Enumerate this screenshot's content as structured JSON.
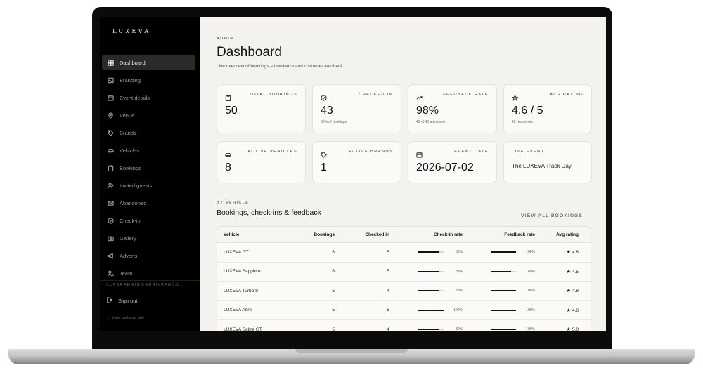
{
  "sidebar": {
    "logo": "LUXEVA",
    "items": [
      {
        "label": "Dashboard",
        "icon": "dashboard-icon",
        "active": true
      },
      {
        "label": "Branding",
        "icon": "image-icon"
      },
      {
        "label": "Event details",
        "icon": "calendar-icon"
      },
      {
        "label": "Venue",
        "icon": "map-pin-icon"
      },
      {
        "label": "Brands",
        "icon": "tag-icon"
      },
      {
        "label": "Vehicles",
        "icon": "car-icon"
      },
      {
        "label": "Bookings",
        "icon": "clipboard-icon"
      },
      {
        "label": "Invited guests",
        "icon": "user-plus-icon"
      },
      {
        "label": "Abandoned",
        "icon": "mail-icon"
      },
      {
        "label": "Check-in",
        "icon": "check-circle-icon"
      },
      {
        "label": "Gallery",
        "icon": "camera-icon"
      },
      {
        "label": "Adverts",
        "icon": "megaphone-icon"
      },
      {
        "label": "Team",
        "icon": "users-icon"
      }
    ],
    "user": "SUPERADMIN@ARRIVEANDO…",
    "sign_out": "Sign out",
    "view_site": "← View customer site"
  },
  "header": {
    "eyebrow": "ADMIN",
    "title": "Dashboard",
    "subtitle": "Live overview of bookings, attendance and customer feedback."
  },
  "stats": {
    "total_bookings": {
      "label": "TOTAL BOOKINGS",
      "value": "50"
    },
    "checked_in": {
      "label": "CHECKED IN",
      "value": "43",
      "sub": "86% of bookings"
    },
    "feedback_rate": {
      "label": "FEEDBACK RATE",
      "value": "98%",
      "sub": "42 of 43 attendees"
    },
    "avg_rating": {
      "label": "AVG RATING",
      "value": "4.6 / 5",
      "sub": "42 responses"
    },
    "active_vehicles": {
      "label": "ACTIVE VEHICLES",
      "value": "8"
    },
    "active_brands": {
      "label": "ACTIVE BRANDS",
      "value": "1"
    },
    "event_date": {
      "label": "EVENT DATE",
      "value": "2026-07-02"
    },
    "live_event": {
      "label": "LIVE EVENT",
      "value": "The LUXEVA Track Day"
    }
  },
  "section": {
    "eyebrow": "BY VEHICLE",
    "title": "Bookings, check-ins & feedback",
    "view_all": "VIEW ALL BOOKINGS →"
  },
  "table": {
    "headers": [
      "Vehicle",
      "Bookings",
      "Checked in",
      "Check-in rate",
      "Feedback rate",
      "Avg rating"
    ],
    "rows": [
      {
        "vehicle": "LUXEVA GT",
        "bookings": "6",
        "checked_in": "5",
        "checkin_rate": "83%",
        "checkin_frac": 0.83,
        "feedback_rate": "100%",
        "feedback_frac": 1.0,
        "avg_rating": "4.6"
      },
      {
        "vehicle": "LUXEVA Sapphire",
        "bookings": "6",
        "checked_in": "5",
        "checkin_rate": "83%",
        "checkin_frac": 0.83,
        "feedback_rate": "80%",
        "feedback_frac": 0.8,
        "avg_rating": "4.5"
      },
      {
        "vehicle": "LUXEVA Turbo S",
        "bookings": "5",
        "checked_in": "4",
        "checkin_rate": "80%",
        "checkin_frac": 0.8,
        "feedback_rate": "100%",
        "feedback_frac": 1.0,
        "avg_rating": "4.8"
      },
      {
        "vehicle": "LUXEVA Aero",
        "bookings": "5",
        "checked_in": "5",
        "checkin_rate": "100%",
        "checkin_frac": 1.0,
        "feedback_rate": "100%",
        "feedback_frac": 1.0,
        "avg_rating": "4.6"
      },
      {
        "vehicle": "LUXEVA Sabre GT",
        "bookings": "5",
        "checked_in": "4",
        "checkin_rate": "80%",
        "checkin_frac": 0.8,
        "feedback_rate": "100%",
        "feedback_frac": 1.0,
        "avg_rating": "5.0"
      }
    ]
  },
  "colors": {
    "sidebar_bg": "#000000",
    "main_bg": "#f3f2ee",
    "card_bg": "#fbfaf7",
    "accent": "#111111"
  }
}
